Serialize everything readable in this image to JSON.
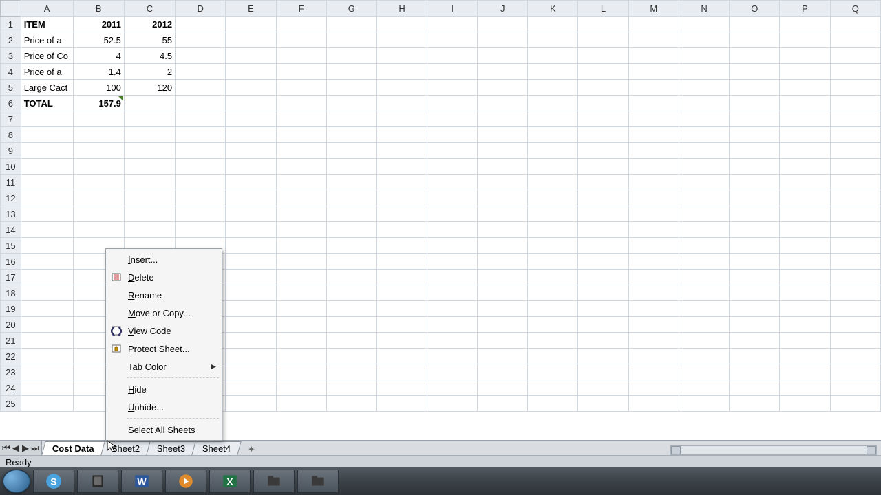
{
  "columns": [
    "A",
    "B",
    "C",
    "D",
    "E",
    "F",
    "G",
    "H",
    "I",
    "J",
    "K",
    "L",
    "M",
    "N",
    "O",
    "P",
    "Q"
  ],
  "row_count": 25,
  "cells": {
    "r1": {
      "A": "ITEM",
      "B": "2011",
      "C": "2012"
    },
    "r2": {
      "A": "Price of a",
      "B": "52.5",
      "C": "55"
    },
    "r3": {
      "A": "Price of Co",
      "B": "4",
      "C": "4.5"
    },
    "r4": {
      "A": "Price of a",
      "B": "1.4",
      "C": "2"
    },
    "r5": {
      "A": "Large Cact",
      "B": "100",
      "C": "120"
    },
    "r6": {
      "A": "TOTAL",
      "B": "157.9",
      "C": ""
    }
  },
  "bold_cells": [
    "r1A",
    "r1B",
    "r1C",
    "r6A",
    "r6B"
  ],
  "marker_cells": [
    "r6B"
  ],
  "sheet_tabs": [
    {
      "label": "Cost Data",
      "active": true
    },
    {
      "label": "Sheet2",
      "active": false
    },
    {
      "label": "Sheet3",
      "active": false
    },
    {
      "label": "Sheet4",
      "active": false
    }
  ],
  "context_menu": [
    {
      "label": "Insert...",
      "accel": "I",
      "icon": "",
      "submenu": false
    },
    {
      "label": "Delete",
      "accel": "D",
      "icon": "delete",
      "submenu": false
    },
    {
      "label": "Rename",
      "accel": "R",
      "icon": "",
      "submenu": false
    },
    {
      "label": "Move or Copy...",
      "accel": "M",
      "icon": "",
      "submenu": false
    },
    {
      "label": "View Code",
      "accel": "V",
      "icon": "code",
      "submenu": false
    },
    {
      "label": "Protect Sheet...",
      "accel": "P",
      "icon": "protect",
      "submenu": false
    },
    {
      "label": "Tab Color",
      "accel": "T",
      "icon": "",
      "submenu": true
    },
    {
      "sep": true
    },
    {
      "label": "Hide",
      "accel": "H",
      "icon": "",
      "submenu": false
    },
    {
      "label": "Unhide...",
      "accel": "U",
      "icon": "",
      "submenu": false,
      "disabled": false
    },
    {
      "sep": true
    },
    {
      "label": "Select All Sheets",
      "accel": "S",
      "icon": "",
      "submenu": false
    }
  ],
  "status_text": "Ready",
  "taskbar": [
    {
      "name": "start"
    },
    {
      "name": "skype"
    },
    {
      "name": "tablet"
    },
    {
      "name": "word"
    },
    {
      "name": "media"
    },
    {
      "name": "excel"
    },
    {
      "name": "folder1"
    },
    {
      "name": "folder2"
    }
  ]
}
